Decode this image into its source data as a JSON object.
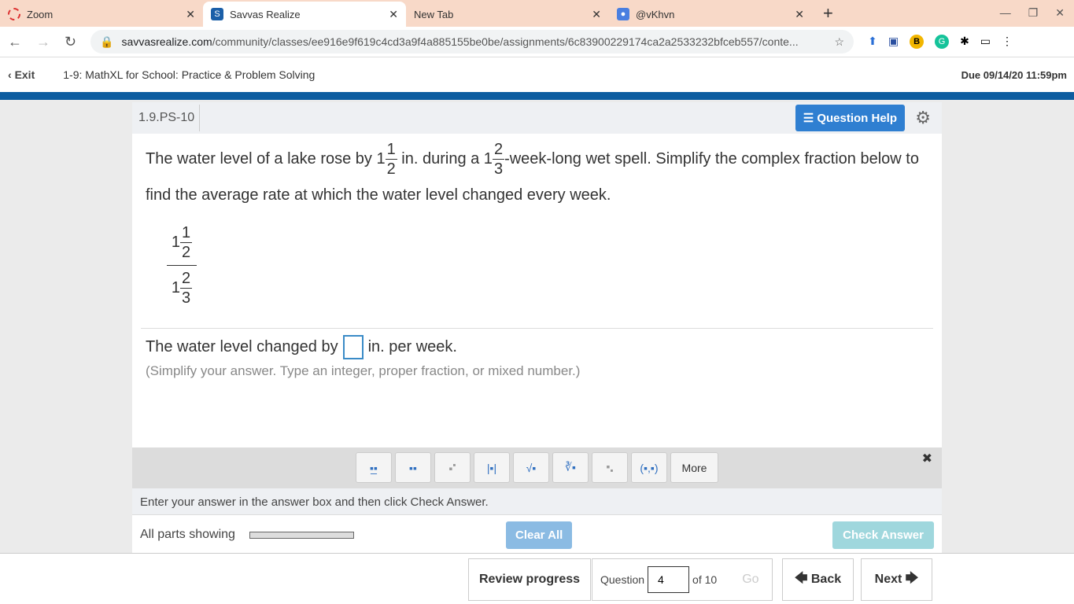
{
  "browser": {
    "tabs": [
      {
        "label": "Zoom"
      },
      {
        "label": "Savvas Realize"
      },
      {
        "label": "New Tab"
      },
      {
        "label": "@vKhvn"
      }
    ],
    "url_domain": "savvasrealize.com",
    "url_path": "/community/classes/ee916e9f619c4cd3a9f4a885155be0be/assignments/6c83900229174ca2a2533232bfceb557/conte...",
    "ext_b": "B",
    "ext_g": "G"
  },
  "header": {
    "exit": "Exit",
    "title": "1-9: MathXL for School: Practice & Problem Solving",
    "due": "Due 09/14/20 11:59pm"
  },
  "question": {
    "id": "1.9.PS-10",
    "help": "Question Help",
    "t1": "The water level of a lake rose by 1",
    "f1n": "1",
    "f1d": "2",
    "t2": " in. during a 1",
    "f2n": "2",
    "f2d": "3",
    "t3": "-week-long wet spell. Simplify the complex fraction below to find the average rate at which the water level changed every week.",
    "cf": {
      "top_whole": "1",
      "top_n": "1",
      "top_d": "2",
      "bot_whole": "1",
      "bot_n": "2",
      "bot_d": "3"
    },
    "ans_pre": "The water level changed by",
    "ans_post": "in. per week.",
    "hint": "(Simplify your answer. Type an integer, proper fraction, or mixed number.)"
  },
  "toolbar": {
    "more": "More"
  },
  "instructions": "Enter your answer in the answer box and then click Check Answer.",
  "footer": {
    "all_parts": "All parts showing",
    "clear_all": "Clear All",
    "check_answer": "Check Answer",
    "progress": 0
  },
  "nav": {
    "review": "Review progress",
    "question_label": "Question",
    "question_value": "4",
    "of": "of 10",
    "go": "Go",
    "back": "Back",
    "next": "Next"
  }
}
